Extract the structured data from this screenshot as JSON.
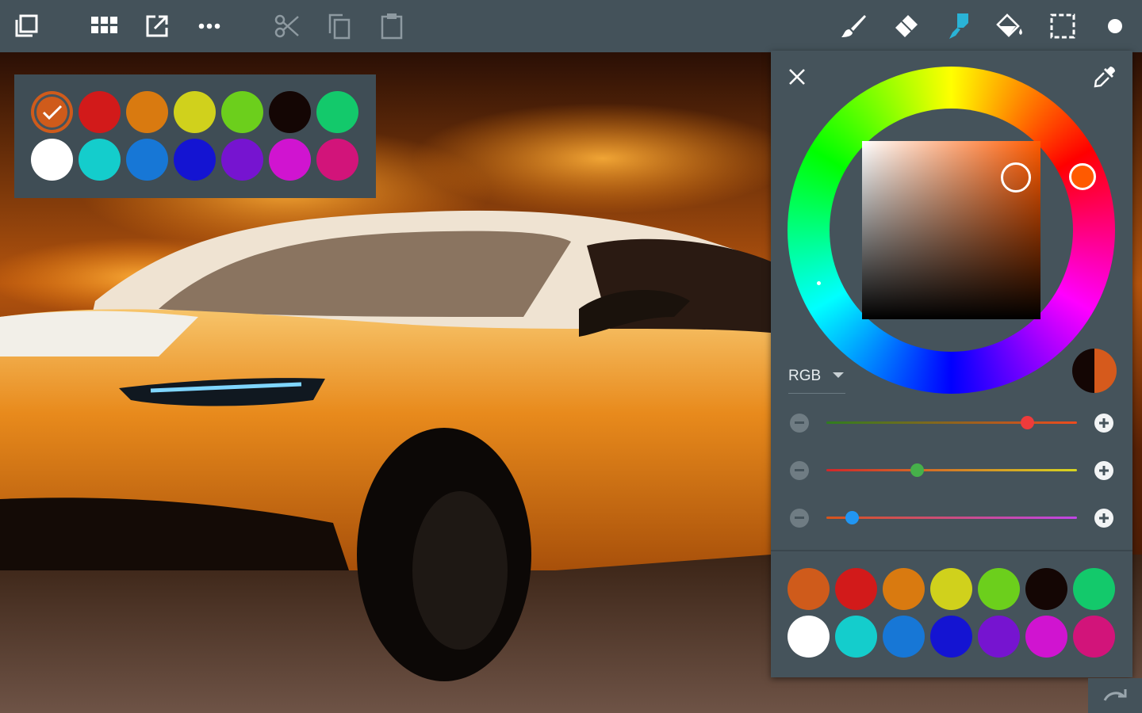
{
  "toolbar": {
    "left_tools": [
      {
        "name": "layers-button",
        "icon": "layers-icon"
      },
      {
        "name": "gallery-button",
        "icon": "grid-icon"
      },
      {
        "name": "export-button",
        "icon": "open-external-icon"
      },
      {
        "name": "more-button",
        "icon": "more-horizontal-icon"
      },
      {
        "name": "cut-button",
        "icon": "scissors-icon"
      },
      {
        "name": "copy-button",
        "icon": "copy-icon"
      },
      {
        "name": "paste-button",
        "icon": "clipboard-icon"
      }
    ],
    "right_tools": [
      {
        "name": "brush-tool",
        "icon": "brush-icon",
        "active": false
      },
      {
        "name": "eraser-tool",
        "icon": "eraser-icon",
        "active": false
      },
      {
        "name": "smudge-tool",
        "icon": "smudge-icon",
        "active": true
      },
      {
        "name": "fill-tool",
        "icon": "paint-bucket-icon",
        "active": false
      },
      {
        "name": "selection-tool",
        "icon": "dashed-selection-icon",
        "active": false
      },
      {
        "name": "brush-size-indicator",
        "icon": "dot-icon",
        "active": false
      }
    ],
    "active_color": "#2ab3d6",
    "icon_color": "#ffffff",
    "disabled_icon_color": "#8e9aa1"
  },
  "quick_palette": {
    "selected_index": 0,
    "swatches": [
      "#cf5b1b",
      "#d21a1a",
      "#d97a10",
      "#d0d11c",
      "#6ccf1c",
      "#140604",
      "#13c96b",
      "#ffffff",
      "#14cdcc",
      "#1777d6",
      "#1414d2",
      "#7614d0",
      "#d014d0",
      "#d2147a"
    ]
  },
  "color_panel": {
    "close_icon": "close-icon",
    "eyedropper_icon": "eyedropper-icon",
    "current_color": "#d65a1c",
    "previous_color": "#140604",
    "mode_label": "RGB",
    "mode_options": [
      "RGB"
    ],
    "sliders": [
      {
        "name": "red",
        "value": 0.8,
        "thumb_color": "#ee3b3b",
        "gradient_from": "#2f7d1f",
        "gradient_to": "#ee4b1e"
      },
      {
        "name": "green",
        "value": 0.36,
        "thumb_color": "#46b04a",
        "gradient_from": "#d2262a",
        "gradient_to": "#d6d620"
      },
      {
        "name": "blue",
        "value": 0.1,
        "thumb_color": "#2196f3",
        "gradient_from": "#d6541a",
        "gradient_to": "#c046e6"
      }
    ],
    "swatches": [
      "#cf5b1b",
      "#d21a1a",
      "#d97a10",
      "#d0d11c",
      "#6ccf1c",
      "#140604",
      "#13c96b",
      "#ffffff",
      "#14cdcc",
      "#1777d6",
      "#1414d2",
      "#7614d0",
      "#d014d0",
      "#d2147a"
    ]
  },
  "history_icon": "redo-icon"
}
